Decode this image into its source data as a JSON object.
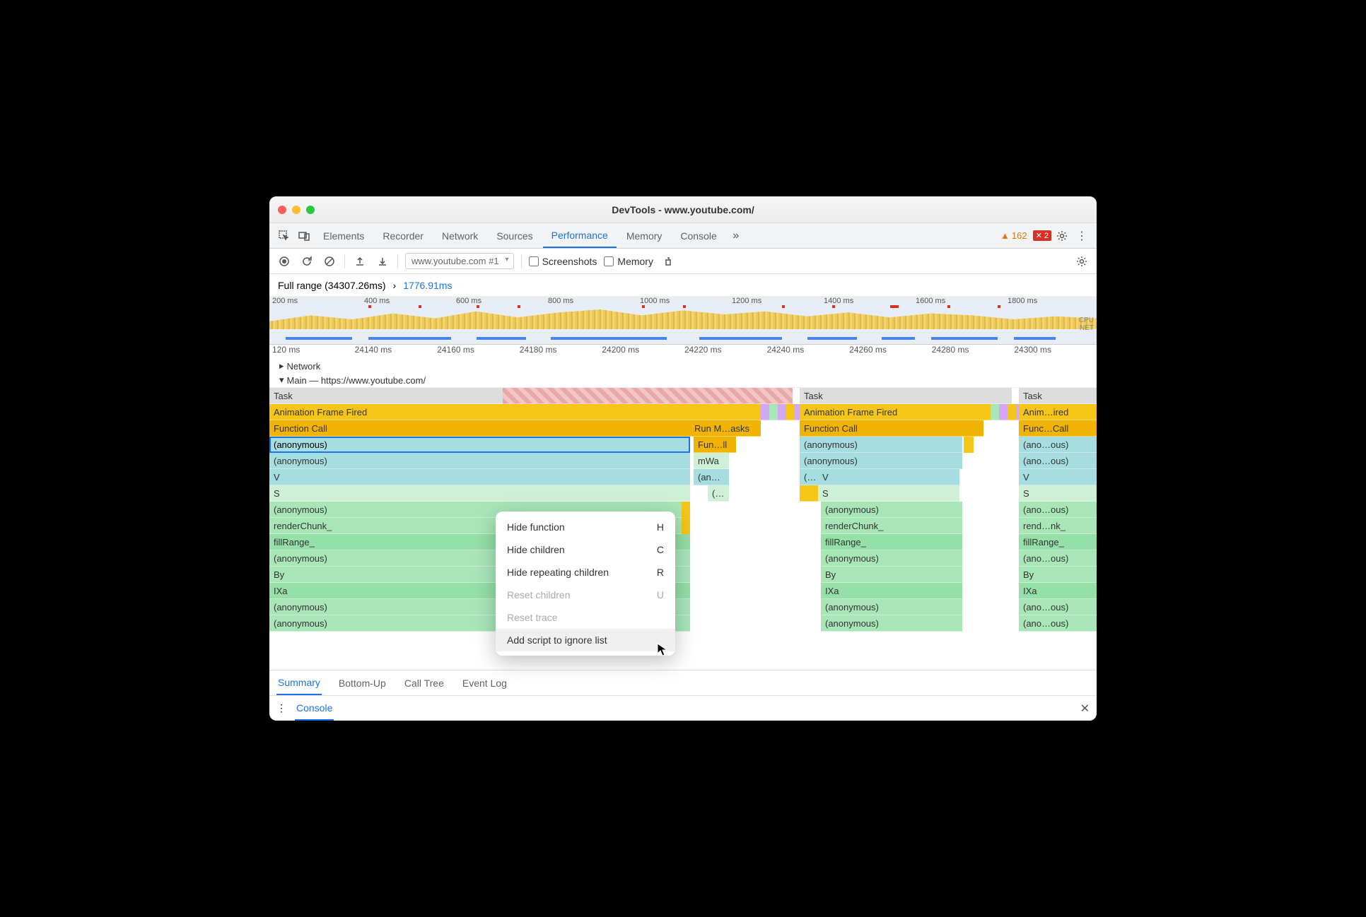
{
  "window_title": "DevTools - www.youtube.com/",
  "tabs": [
    "Elements",
    "Recorder",
    "Network",
    "Sources",
    "Performance",
    "Memory",
    "Console"
  ],
  "active_tab": "Performance",
  "warn_count": "162",
  "err_count": "2",
  "toolbar": {
    "recording_select": "www.youtube.com #1",
    "screenshots": "Screenshots",
    "memory": "Memory"
  },
  "breadcrumb": {
    "full": "Full range (34307.26ms)",
    "sep": "›",
    "zoom": "1776.91ms"
  },
  "overview_ticks": [
    "200 ms",
    "400 ms",
    "600 ms",
    "800 ms",
    "1000 ms",
    "1200 ms",
    "1400 ms",
    "1600 ms",
    "1800 ms"
  ],
  "overview_labels": {
    "cpu": "CPU",
    "net": "NET"
  },
  "timeline_ticks": [
    "120 ms",
    "24140 ms",
    "24160 ms",
    "24180 ms",
    "24200 ms",
    "24220 ms",
    "24240 ms",
    "24260 ms",
    "24280 ms",
    "24300 ms"
  ],
  "tracks": {
    "network": "Network",
    "main": "Main — https://www.youtube.com/"
  },
  "flame": {
    "col1": {
      "task": "Task",
      "aff": "Animation Frame Fired",
      "fc": "Function Call",
      "anon1": "(anonymous)",
      "anon2": "(anonymous)",
      "v": "V",
      "s": "S",
      "anon3": "(anonymous)",
      "render": "renderChunk_",
      "fill": "fillRange_",
      "anon4": "(anonymous)",
      "by": "By",
      "ixa": "IXa",
      "anon5": "(anonymous)",
      "anon6": "(anonymous)",
      "run": "Run M…asks",
      "funll": "Fun…ll",
      "mwa": "mWa",
      "ans": "(an…s)",
      "paren": "(…"
    },
    "col2": {
      "task": "Task",
      "aff": "Animation Frame Fired",
      "fc": "Function Call",
      "anon1": "(anonymous)",
      "anon2": "(anonymous)",
      "p": "(…",
      "v": "V",
      "s": "S",
      "anon3": "(anonymous)",
      "render": "renderChunk_",
      "fill": "fillRange_",
      "anon4": "(anonymous)",
      "by": "By",
      "ixa": "IXa",
      "anon5": "(anonymous)",
      "anon6": "(anonymous)"
    },
    "col3": {
      "task": "Task",
      "aff": "Anim…ired",
      "fc": "Func…Call",
      "anon1": "(ano…ous)",
      "anon2": "(ano…ous)",
      "v": "V",
      "s": "S",
      "anon3": "(ano…ous)",
      "render": "rend…nk_",
      "fill": "fillRange_",
      "anon4": "(ano…ous)",
      "by": "By",
      "ixa": "IXa",
      "anon5": "(ano…ous)",
      "anon6": "(ano…ous)"
    }
  },
  "context_menu": [
    {
      "label": "Hide function",
      "key": "H",
      "enabled": true
    },
    {
      "label": "Hide children",
      "key": "C",
      "enabled": true
    },
    {
      "label": "Hide repeating children",
      "key": "R",
      "enabled": true
    },
    {
      "label": "Reset children",
      "key": "U",
      "enabled": false
    },
    {
      "label": "Reset trace",
      "key": "",
      "enabled": false
    },
    {
      "label": "Add script to ignore list",
      "key": "",
      "enabled": true,
      "hover": true
    }
  ],
  "bottom_tabs": [
    "Summary",
    "Bottom-Up",
    "Call Tree",
    "Event Log"
  ],
  "active_bottom_tab": "Summary",
  "console_label": "Console"
}
